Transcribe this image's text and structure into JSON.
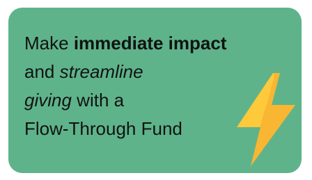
{
  "card": {
    "line1": {
      "prefix": "Make ",
      "bold": "immediate impact"
    },
    "line2": {
      "prefix": "and ",
      "italic": "streamline"
    },
    "line3": {
      "italic": "giving",
      "suffix": " with a"
    },
    "line4": {
      "text": "Flow-Through Fund"
    },
    "icon": "lightning-bolt-icon",
    "colors": {
      "card_background": "#5fb38a",
      "text": "#101313",
      "bolt_fill": "#ffc93c",
      "bolt_shadow": "#f3a629"
    }
  }
}
